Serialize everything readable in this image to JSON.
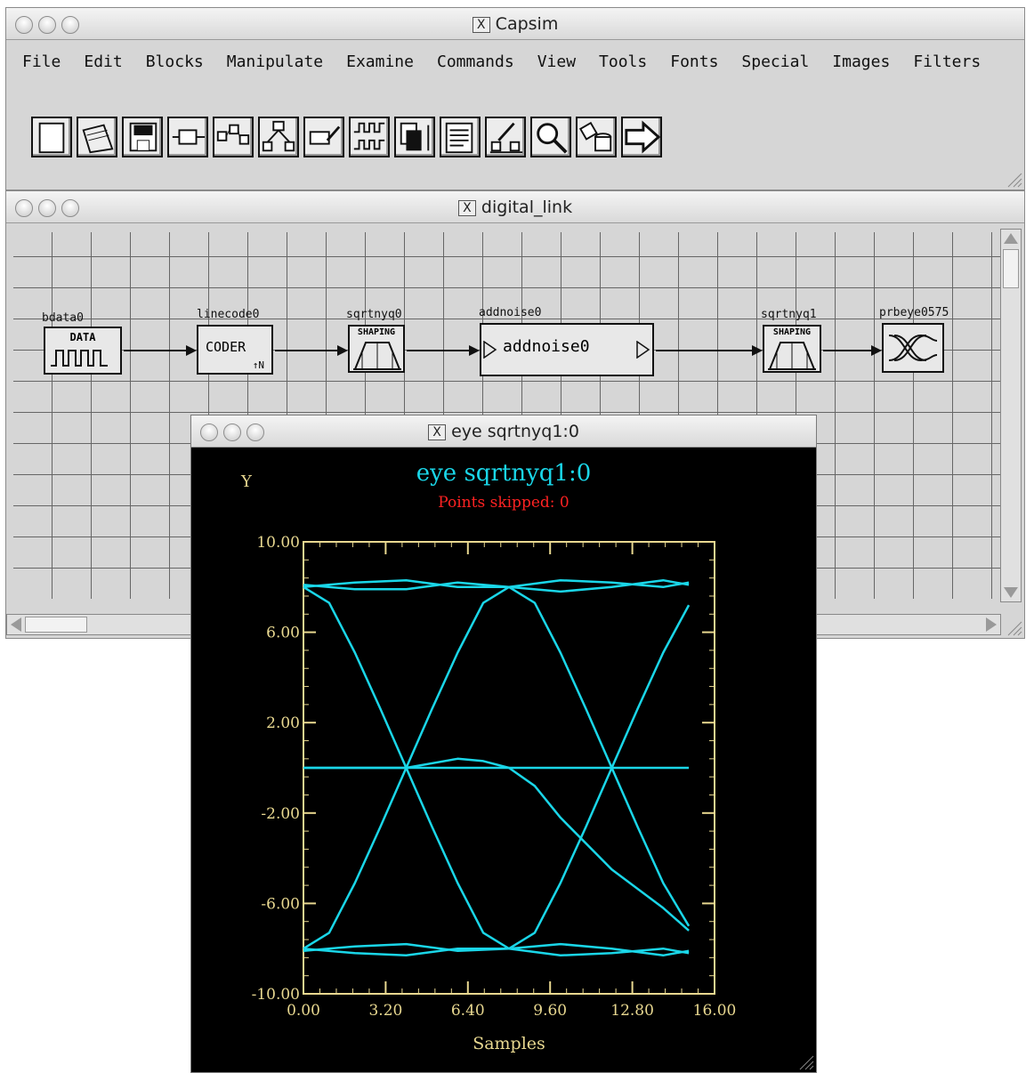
{
  "capsim": {
    "title": "Capsim",
    "x_glyph": "X",
    "menu": [
      "File",
      "Edit",
      "Blocks",
      "Manipulate",
      "Examine",
      "Commands",
      "View",
      "Tools",
      "Fonts",
      "Special",
      "Images",
      "Filters"
    ],
    "toolbar_icons": [
      "new-icon",
      "open-icon",
      "save-icon",
      "block-icon",
      "connect-icon",
      "hierarchy-icon",
      "probe-icon",
      "waveform-icon",
      "copy-icon",
      "text-icon",
      "chart-icon",
      "search-icon",
      "database-icon",
      "run-icon"
    ]
  },
  "digital_link": {
    "title": "digital_link",
    "blocks": [
      {
        "label": "bdata0",
        "inner": "DATA"
      },
      {
        "label": "linecode0",
        "inner": "CODER"
      },
      {
        "label": "sqrtnyq0",
        "inner": "SHAPING"
      },
      {
        "label": "addnoise0",
        "inner": "addnoise0"
      },
      {
        "label": "sqrtnyq1",
        "inner": "SHAPING"
      },
      {
        "label": "prbeye0575",
        "inner": ""
      }
    ],
    "coder_sub": "↑N"
  },
  "eye_window": {
    "title": "eye sqrtnyq1:0",
    "plot_title": "eye sqrtnyq1:0",
    "subtitle": "Points skipped: 0",
    "y_label": "Y"
  },
  "colors": {
    "trace": "#1ad6e8",
    "axis": "#e8d890",
    "subtitle": "#ff2222",
    "background": "#000000"
  },
  "chart_data": {
    "type": "line",
    "title": "eye sqrtnyq1:0",
    "subtitle": "Points skipped: 0",
    "xlabel": "Samples",
    "ylabel": "Y",
    "xlim": [
      0,
      16
    ],
    "ylim": [
      -10,
      10
    ],
    "xticks": [
      "0.00",
      "3.20",
      "6.40",
      "9.60",
      "12.80",
      "16.00"
    ],
    "yticks": [
      "10.00",
      "6.00",
      "2.00",
      "-2.00",
      "-6.00",
      "-10.00"
    ],
    "series": [
      {
        "x": [
          0,
          2,
          4,
          6,
          8,
          10,
          12,
          14,
          15
        ],
        "y": [
          8,
          8.2,
          8.3,
          8,
          8,
          8.3,
          8.2,
          8,
          8.2
        ]
      },
      {
        "x": [
          0,
          2,
          4,
          6,
          8,
          10,
          12,
          14,
          15
        ],
        "y": [
          8.1,
          7.9,
          7.9,
          8.2,
          8,
          7.8,
          8,
          8.3,
          8.1
        ]
      },
      {
        "x": [
          0,
          2,
          4,
          6,
          8,
          10,
          12,
          14,
          15
        ],
        "y": [
          -8,
          -8.2,
          -8.3,
          -8,
          -8,
          -8.3,
          -8.2,
          -8,
          -8.2
        ]
      },
      {
        "x": [
          0,
          2,
          4,
          6,
          8,
          10,
          12,
          14,
          15
        ],
        "y": [
          -8.1,
          -7.9,
          -7.8,
          -8.1,
          -8,
          -7.8,
          -8,
          -8.3,
          -8.1
        ]
      },
      {
        "x": [
          0,
          1,
          2,
          3,
          4,
          5,
          6,
          7,
          8
        ],
        "y": [
          8,
          7.3,
          5.1,
          2.6,
          0,
          -2.6,
          -5.1,
          -7.3,
          -8
        ]
      },
      {
        "x": [
          0,
          1,
          2,
          3,
          4,
          5,
          6,
          7,
          8
        ],
        "y": [
          -8,
          -7.3,
          -5.1,
          -2.6,
          0,
          2.6,
          5.1,
          7.3,
          8
        ]
      },
      {
        "x": [
          8,
          9,
          10,
          11,
          12,
          13,
          14,
          15
        ],
        "y": [
          8,
          7.3,
          5.1,
          2.6,
          0,
          -2.6,
          -5.1,
          -7
        ]
      },
      {
        "x": [
          8,
          9,
          10,
          11,
          12,
          13,
          14,
          15
        ],
        "y": [
          -8,
          -7.3,
          -5.1,
          -2.6,
          0,
          2.6,
          5.1,
          7.2
        ]
      },
      {
        "x": [
          0,
          4,
          6,
          7,
          8,
          9,
          10,
          12,
          14,
          15
        ],
        "y": [
          0,
          0,
          0.4,
          0.3,
          0,
          -0.8,
          -2.2,
          -4.5,
          -6.2,
          -7.2
        ]
      },
      {
        "x": [
          0,
          15
        ],
        "y": [
          0,
          0
        ]
      }
    ]
  }
}
